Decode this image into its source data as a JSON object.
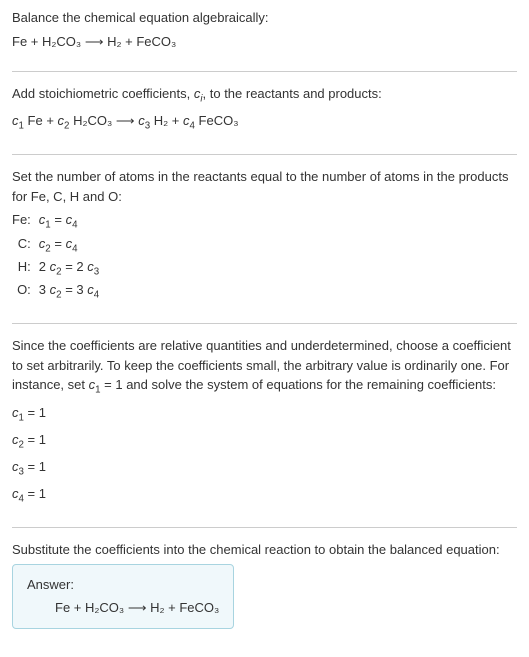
{
  "sections": {
    "title": "Balance the chemical equation algebraically:",
    "eq1": "Fe + H₂CO₃  ⟶  H₂ + FeCO₃",
    "step2_a": "Add stoichiometric coefficients, ",
    "step2_ci": "c",
    "step2_ci_sub": "i",
    "step2_b": ", to the reactants and products:",
    "eq2_c1": "c",
    "eq2_c1s": "1",
    "eq2_fe": " Fe + ",
    "eq2_c2": "c",
    "eq2_c2s": "2",
    "eq2_h2co3": " H₂CO₃  ⟶  ",
    "eq2_c3": "c",
    "eq2_c3s": "3",
    "eq2_h2": " H₂ + ",
    "eq2_c4": "c",
    "eq2_c4s": "4",
    "eq2_feco3": " FeCO₃",
    "step3": "Set the number of atoms in the reactants equal to the number of atoms in the products for Fe, C, H and O:",
    "rows": {
      "fe_label": "Fe:",
      "fe_eq_a": "c",
      "fe_eq_as": "1",
      "fe_eq_mid": " = ",
      "fe_eq_b": "c",
      "fe_eq_bs": "4",
      "c_label": "C:",
      "c_eq_a": "c",
      "c_eq_as": "2",
      "c_eq_mid": " = ",
      "c_eq_b": "c",
      "c_eq_bs": "4",
      "h_label": "H:",
      "h_eq_pre": "2 ",
      "h_eq_a": "c",
      "h_eq_as": "2",
      "h_eq_mid": " = 2 ",
      "h_eq_b": "c",
      "h_eq_bs": "3",
      "o_label": "O:",
      "o_eq_pre": "3 ",
      "o_eq_a": "c",
      "o_eq_as": "2",
      "o_eq_mid": " = 3 ",
      "o_eq_b": "c",
      "o_eq_bs": "4"
    },
    "step4_a": "Since the coefficients are relative quantities and underdetermined, choose a coefficient to set arbitrarily. To keep the coefficients small, the arbitrary value is ordinarily one. For instance, set ",
    "step4_c": "c",
    "step4_cs": "1",
    "step4_b": " = 1 and solve the system of equations for the remaining coefficients:",
    "sol": {
      "l1a": "c",
      "l1s": "1",
      "l1b": " = 1",
      "l2a": "c",
      "l2s": "2",
      "l2b": " = 1",
      "l3a": "c",
      "l3s": "3",
      "l3b": " = 1",
      "l4a": "c",
      "l4s": "4",
      "l4b": " = 1"
    },
    "step5": "Substitute the coefficients into the chemical reaction to obtain the balanced equation:",
    "answer_label": "Answer:",
    "answer_eq": "Fe + H₂CO₃  ⟶  H₂ + FeCO₃"
  }
}
